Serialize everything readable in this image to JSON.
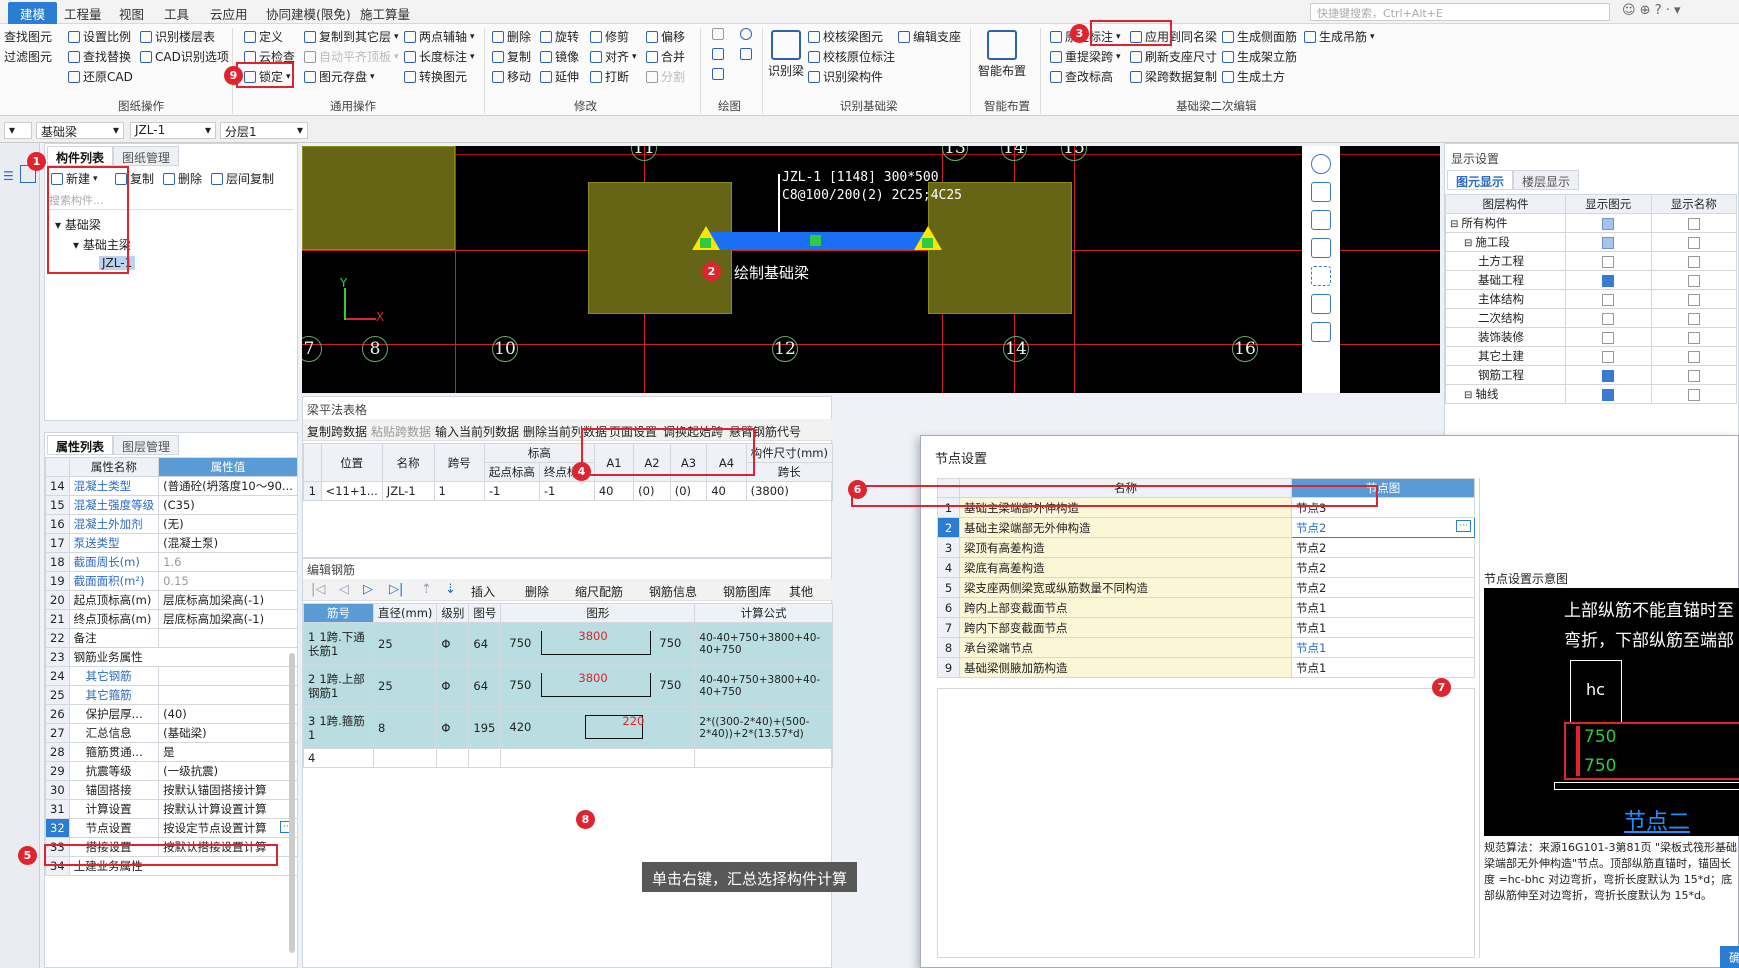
{
  "menu": {
    "items": [
      "建模",
      "工程量",
      "视图",
      "工具",
      "云应用",
      "协同建模(限免)",
      "施工算量"
    ],
    "search_placeholder": "快捷键搜索，Ctrl+Alt+E"
  },
  "toolbar": {
    "col0": [
      "查找图元",
      "过滤图元"
    ],
    "col1": [
      "设置比例",
      "查找替换",
      "还原CAD"
    ],
    "col2": [
      "识别楼层表",
      "CAD识别选项"
    ],
    "group1": "图纸操作",
    "col3": [
      "定义",
      "云检查",
      "锁定"
    ],
    "col4": [
      "复制到其它层",
      "自动平齐顶板",
      "图元存盘"
    ],
    "col5": [
      "两点辅轴",
      "长度标注",
      "转换图元"
    ],
    "group2": "通用操作",
    "col6": [
      "删除",
      "复制",
      "移动"
    ],
    "col7": [
      "旋转",
      "镜像",
      "延伸"
    ],
    "col8": [
      "修剪",
      "对齐",
      "打断"
    ],
    "col9": [
      "偏移",
      "合并",
      "分割"
    ],
    "group3": "修改",
    "group4": "绘图",
    "recog": "识别梁",
    "col10": [
      "校核梁图元",
      "校核原位标注",
      "识别梁构件"
    ],
    "col11": [
      "编辑支座"
    ],
    "group5": "识别基础梁",
    "smart": "智能布置",
    "group6": "智能布置",
    "col12": [
      "原位标注",
      "重提梁跨",
      "查改标高"
    ],
    "col13": [
      "应用到同名梁",
      "刷新支座尺寸",
      "梁跨数据复制"
    ],
    "col14": [
      "生成侧面筋",
      "生成架立筋",
      "生成土方"
    ],
    "col15": [
      "生成吊筋"
    ],
    "group7": "基础梁二次编辑"
  },
  "selectors": [
    "基础梁",
    "JZL-1",
    "分层1"
  ],
  "component_list": {
    "tabs": [
      "构件列表",
      "图纸管理"
    ],
    "actions": [
      "新建",
      "复制",
      "删除",
      "层间复制"
    ],
    "search_placeholder": "搜索构件...",
    "tree": [
      "基础梁",
      "基础主梁",
      "JZL-1"
    ]
  },
  "properties": {
    "tabs": [
      "属性列表",
      "图层管理"
    ],
    "headers": [
      "属性名称",
      "属性值"
    ],
    "rows": [
      {
        "n": "14",
        "name": "混凝土类型",
        "value": "(普通砼(坍落度10～90...",
        "blue": true
      },
      {
        "n": "15",
        "name": "混凝土强度等级",
        "value": "(C35)",
        "blue": true
      },
      {
        "n": "16",
        "name": "混凝土外加剂",
        "value": "(无)",
        "blue": true
      },
      {
        "n": "17",
        "name": "泵送类型",
        "value": "(混凝土泵)",
        "blue": true
      },
      {
        "n": "18",
        "name": "截面周长(m)",
        "value": "1.6",
        "blue": true,
        "gray": true
      },
      {
        "n": "19",
        "name": "截面面积(m²)",
        "value": "0.15",
        "blue": true,
        "gray": true
      },
      {
        "n": "20",
        "name": "起点顶标高(m)",
        "value": "层底标高加梁高(-1)"
      },
      {
        "n": "21",
        "name": "终点顶标高(m)",
        "value": "层底标高加梁高(-1)"
      },
      {
        "n": "22",
        "name": "备注",
        "value": ""
      },
      {
        "n": "23",
        "name": "钢筋业务属性",
        "value": "",
        "group": true
      },
      {
        "n": "24",
        "name": "其它钢筋",
        "value": "",
        "blue": true,
        "indent": true
      },
      {
        "n": "25",
        "name": "其它箍筋",
        "value": "",
        "blue": true,
        "indent": true
      },
      {
        "n": "26",
        "name": "保护层厚...",
        "value": "(40)",
        "indent": true
      },
      {
        "n": "27",
        "name": "汇总信息",
        "value": "(基础梁)",
        "indent": true
      },
      {
        "n": "28",
        "name": "箍筋贯通...",
        "value": "是",
        "indent": true
      },
      {
        "n": "29",
        "name": "抗震等级",
        "value": "(一级抗震)",
        "indent": true
      },
      {
        "n": "30",
        "name": "锚固搭接",
        "value": "按默认锚固搭接计算",
        "indent": true
      },
      {
        "n": "31",
        "name": "计算设置",
        "value": "按默认计算设置计算",
        "indent": true
      },
      {
        "n": "32",
        "name": "节点设置",
        "value": "按设定节点设置计算",
        "indent": true,
        "selected": true
      },
      {
        "n": "33",
        "name": "搭接设置",
        "value": "按默认搭接设置计算",
        "indent": true
      },
      {
        "n": "34",
        "name": "土建业务属性",
        "value": "",
        "group": true
      }
    ]
  },
  "cad": {
    "axes_top": [
      "11",
      "13",
      "14",
      "15"
    ],
    "axes_bottom": [
      "7",
      "8",
      "10",
      "12",
      "14",
      "16"
    ],
    "beam_label_1": "JZL-1 [1148] 300*500",
    "beam_label_2": "C8@100/200(2) 2C25;4C25",
    "annotation": "绘制基础梁",
    "x_label": "X",
    "y_label": "Y"
  },
  "beam_table": {
    "title": "梁平法表格",
    "actions": [
      "复制跨数据",
      "粘贴跨数据",
      "输入当前列数据",
      "删除当前列数据",
      "页面设置",
      "调换起始跨",
      "悬臂钢筋代号"
    ],
    "headers": [
      "位置",
      "名称",
      "跨号",
      "标高",
      "起点标高",
      "终点标高",
      "A1",
      "A2",
      "A3",
      "A4",
      "构件尺寸(mm)",
      "跨长"
    ],
    "row": [
      "1",
      "<11+1...",
      "JZL-1",
      "1",
      "-1",
      "-1",
      "40",
      "(0)",
      "(0)",
      "40",
      "(3800)"
    ]
  },
  "rebar": {
    "title": "编辑钢筋",
    "actions": [
      "插入",
      "删除",
      "缩尺配筋",
      "钢筋信息",
      "钢筋图库",
      "其他"
    ],
    "headers": [
      "筋号",
      "直径(mm)",
      "级别",
      "图号",
      "图形",
      "计算公式"
    ],
    "rows": [
      {
        "n": "1",
        "name": "1跨.下通长筋1",
        "dia": "25",
        "grade": "Φ",
        "fig": "64",
        "l": "750",
        "mid": "3800",
        "r": "750",
        "formula": "40-40+750+3800+40-40+750"
      },
      {
        "n": "2",
        "name": "1跨.上部钢筋1",
        "dia": "25",
        "grade": "Φ",
        "fig": "64",
        "l": "750",
        "mid": "3800",
        "r": "750",
        "formula": "40-40+750+3800+40-40+750"
      },
      {
        "n": "3",
        "name": "1跨.箍筋1",
        "dia": "8",
        "grade": "Φ",
        "fig": "195",
        "l": "420",
        "mid": "220",
        "r": "",
        "formula": "2*((300-2*40)+(500-2*40))+2*(13.57*d)"
      }
    ],
    "empty_row": "4"
  },
  "tooltip": "单击右键，汇总选择构件计算",
  "display": {
    "title": "显示设置",
    "tabs": [
      "图元显示",
      "楼层显示"
    ],
    "headers": [
      "图层构件",
      "显示图元",
      "显示名称"
    ],
    "rows": [
      {
        "name": "所有构件",
        "a": "half",
        "b": "off",
        "level": 0
      },
      {
        "name": "施工段",
        "a": "half",
        "b": "off",
        "level": 1
      },
      {
        "name": "土方工程",
        "a": "off",
        "b": "off",
        "level": 2
      },
      {
        "name": "基础工程",
        "a": "on",
        "b": "off",
        "level": 2
      },
      {
        "name": "主体结构",
        "a": "off",
        "b": "off",
        "level": 2
      },
      {
        "name": "二次结构",
        "a": "off",
        "b": "off",
        "level": 2
      },
      {
        "name": "装饰装修",
        "a": "off",
        "b": "off",
        "level": 2
      },
      {
        "name": "其它土建",
        "a": "off",
        "b": "off",
        "level": 2
      },
      {
        "name": "钢筋工程",
        "a": "on",
        "b": "off",
        "level": 2
      },
      {
        "name": "轴线",
        "a": "on",
        "b": "off",
        "level": 1
      }
    ]
  },
  "node_dialog": {
    "title": "节点设置",
    "headers": [
      "名称",
      "节点图"
    ],
    "rows": [
      {
        "n": "1",
        "name": "基础主梁端部外伸构造",
        "node": "节点3"
      },
      {
        "n": "2",
        "name": "基础主梁端部无外伸构造",
        "node": "节点2",
        "selected": true
      },
      {
        "n": "3",
        "name": "梁顶有高差构造",
        "node": "节点2"
      },
      {
        "n": "4",
        "name": "梁底有高差构造",
        "node": "节点2"
      },
      {
        "n": "5",
        "name": "梁支座两侧梁宽或纵筋数量不同构造",
        "node": "节点2"
      },
      {
        "n": "6",
        "name": "跨内上部变截面节点",
        "node": "节点1"
      },
      {
        "n": "7",
        "name": "跨内下部变截面节点",
        "node": "节点1"
      },
      {
        "n": "8",
        "name": "承台梁端节点",
        "node": "节点1",
        "blue": true
      },
      {
        "n": "9",
        "name": "基础梁侧腋加筋构造",
        "node": "节点1"
      }
    ],
    "diagram_title": "节点设置示意图",
    "diagram_text1": "上部纵筋不能直锚时至",
    "diagram_text2": "弯折，下部纵筋至端部",
    "hc": "hc",
    "dim1": "750",
    "dim2": "750",
    "node_name": "节点二",
    "desc": "规范算法：来源16G101-3第81页 \"梁板式筏形基础梁端部无外伸构造\"节点。顶部纵筋直锚时，锚固长度 =hc-bhc 对边弯折，弯折长度默认为 15*d；底部纵筋伸至对边弯折，弯折长度默认为 15*d。",
    "ok": "确"
  },
  "badges": [
    "1",
    "2",
    "3",
    "4",
    "5",
    "6",
    "7",
    "8",
    "9"
  ],
  "colors": {
    "accent": "#2b7cd3",
    "highlight": "#e0242f",
    "beam": "#1a6ff2",
    "column": "#656515"
  }
}
